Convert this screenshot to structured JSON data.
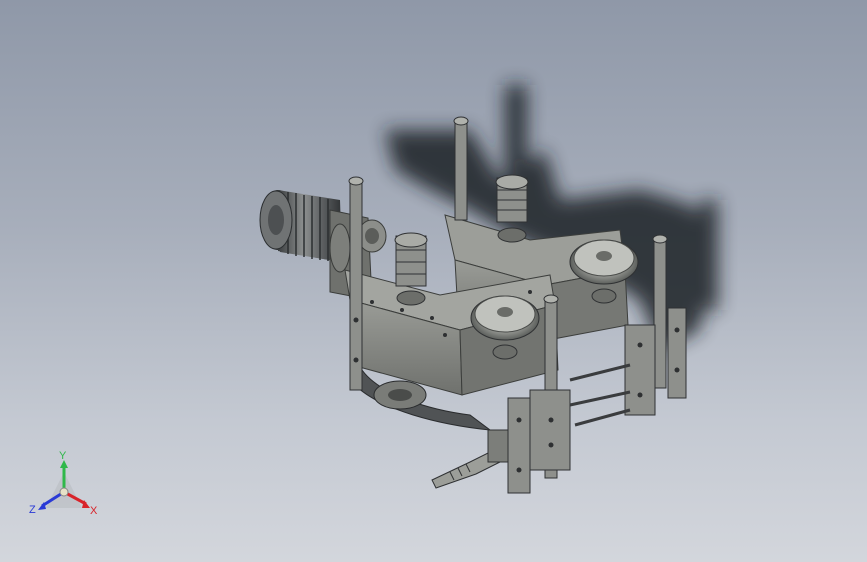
{
  "viewport": {
    "background_top": "#8f98a8",
    "background_bottom": "#d3d6dc"
  },
  "triad": {
    "x_label": "X",
    "y_label": "Y",
    "z_label": "Z",
    "x_color": "#d8232a",
    "y_color": "#2fb84a",
    "z_color": "#2a3ad6"
  },
  "model": {
    "body_color": "#8a8c88",
    "dark_color": "#4a4d4f",
    "light_color": "#b9bbb6",
    "shadow_color": "#1f2226"
  }
}
